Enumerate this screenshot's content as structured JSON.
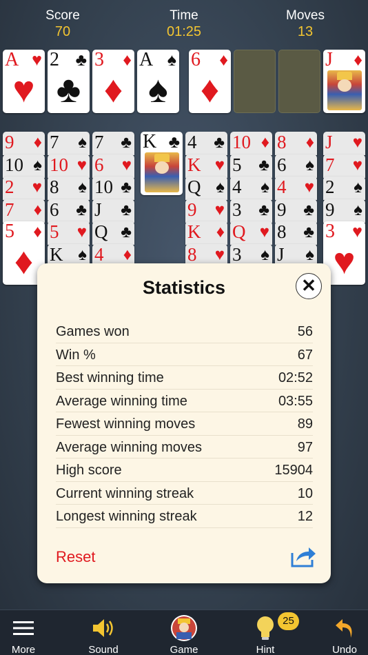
{
  "stats": {
    "score_label": "Score",
    "score_value": "70",
    "time_label": "Time",
    "time_value": "01:25",
    "moves_label": "Moves",
    "moves_value": "13"
  },
  "top_row": [
    {
      "rank": "A",
      "suit": "♥",
      "color": "red"
    },
    {
      "rank": "2",
      "suit": "♣",
      "color": "blk"
    },
    {
      "rank": "3",
      "suit": "♦",
      "color": "red"
    },
    {
      "rank": "A",
      "suit": "♠",
      "color": "blk"
    },
    {
      "rank": "6",
      "suit": "♦",
      "color": "red"
    },
    {
      "empty": true
    },
    {
      "empty": true
    },
    {
      "rank": "J",
      "suit": "♦",
      "color": "red",
      "face": true
    }
  ],
  "tableau": [
    {
      "cards": [
        {
          "rank": "9",
          "suit": "♦",
          "color": "red"
        },
        {
          "rank": "10",
          "suit": "♠",
          "color": "blk"
        },
        {
          "rank": "2",
          "suit": "♥",
          "color": "red"
        },
        {
          "rank": "7",
          "suit": "♦",
          "color": "red"
        },
        {
          "rank": "5",
          "suit": "♦",
          "color": "red",
          "last": true
        }
      ]
    },
    {
      "cards": [
        {
          "rank": "7",
          "suit": "♠",
          "color": "blk"
        },
        {
          "rank": "10",
          "suit": "♥",
          "color": "red"
        },
        {
          "rank": "8",
          "suit": "♠",
          "color": "blk"
        },
        {
          "rank": "6",
          "suit": "♣",
          "color": "blk"
        },
        {
          "rank": "5",
          "suit": "♥",
          "color": "red"
        },
        {
          "rank": "K",
          "suit": "♠",
          "color": "blk"
        }
      ]
    },
    {
      "cards": [
        {
          "rank": "7",
          "suit": "♣",
          "color": "blk"
        },
        {
          "rank": "6",
          "suit": "♥",
          "color": "red"
        },
        {
          "rank": "10",
          "suit": "♣",
          "color": "blk"
        },
        {
          "rank": "J",
          "suit": "♣",
          "color": "blk"
        },
        {
          "rank": "Q",
          "suit": "♣",
          "color": "blk"
        },
        {
          "rank": "4",
          "suit": "♦",
          "color": "red"
        }
      ]
    },
    {
      "cards": [
        {
          "rank": "K",
          "suit": "♣",
          "color": "blk",
          "face": true,
          "last": true
        }
      ]
    },
    {
      "cards": [
        {
          "rank": "4",
          "suit": "♣",
          "color": "blk"
        },
        {
          "rank": "K",
          "suit": "♥",
          "color": "red"
        },
        {
          "rank": "Q",
          "suit": "♠",
          "color": "blk"
        },
        {
          "rank": "9",
          "suit": "♥",
          "color": "red"
        },
        {
          "rank": "K",
          "suit": "♦",
          "color": "red"
        },
        {
          "rank": "8",
          "suit": "♥",
          "color": "red"
        }
      ]
    },
    {
      "cards": [
        {
          "rank": "10",
          "suit": "♦",
          "color": "red"
        },
        {
          "rank": "5",
          "suit": "♣",
          "color": "blk"
        },
        {
          "rank": "4",
          "suit": "♠",
          "color": "blk"
        },
        {
          "rank": "3",
          "suit": "♣",
          "color": "blk"
        },
        {
          "rank": "Q",
          "suit": "♥",
          "color": "red"
        },
        {
          "rank": "3",
          "suit": "♠",
          "color": "blk"
        }
      ]
    },
    {
      "cards": [
        {
          "rank": "8",
          "suit": "♦",
          "color": "red"
        },
        {
          "rank": "6",
          "suit": "♠",
          "color": "blk"
        },
        {
          "rank": "4",
          "suit": "♥",
          "color": "red"
        },
        {
          "rank": "9",
          "suit": "♣",
          "color": "blk"
        },
        {
          "rank": "8",
          "suit": "♣",
          "color": "blk"
        },
        {
          "rank": "J",
          "suit": "♠",
          "color": "blk"
        }
      ]
    },
    {
      "cards": [
        {
          "rank": "J",
          "suit": "♥",
          "color": "red"
        },
        {
          "rank": "7",
          "suit": "♥",
          "color": "red"
        },
        {
          "rank": "2",
          "suit": "♠",
          "color": "blk"
        },
        {
          "rank": "9",
          "suit": "♠",
          "color": "blk"
        },
        {
          "rank": "3",
          "suit": "♥",
          "color": "red",
          "last": true
        }
      ]
    }
  ],
  "modal": {
    "title": "Statistics",
    "close_glyph": "✕",
    "rows": [
      {
        "label": "Games won",
        "value": "56"
      },
      {
        "label": "Win %",
        "value": "67"
      },
      {
        "label": "Best winning time",
        "value": "02:52"
      },
      {
        "label": "Average winning time",
        "value": "03:55"
      },
      {
        "label": "Fewest winning moves",
        "value": "89"
      },
      {
        "label": "Average winning moves",
        "value": "97"
      },
      {
        "label": "High score",
        "value": "15904"
      },
      {
        "label": "Current winning streak",
        "value": "10"
      },
      {
        "label": "Longest winning streak",
        "value": "12"
      }
    ],
    "reset_label": "Reset"
  },
  "toolbar": {
    "more_label": "More",
    "sound_label": "Sound",
    "game_label": "Game",
    "hint_label": "Hint",
    "hint_badge": "25",
    "undo_label": "Undo"
  },
  "colors": {
    "accent_yellow": "#f3c531",
    "red": "#e0191f",
    "modal_bg": "#fdf6e5"
  }
}
